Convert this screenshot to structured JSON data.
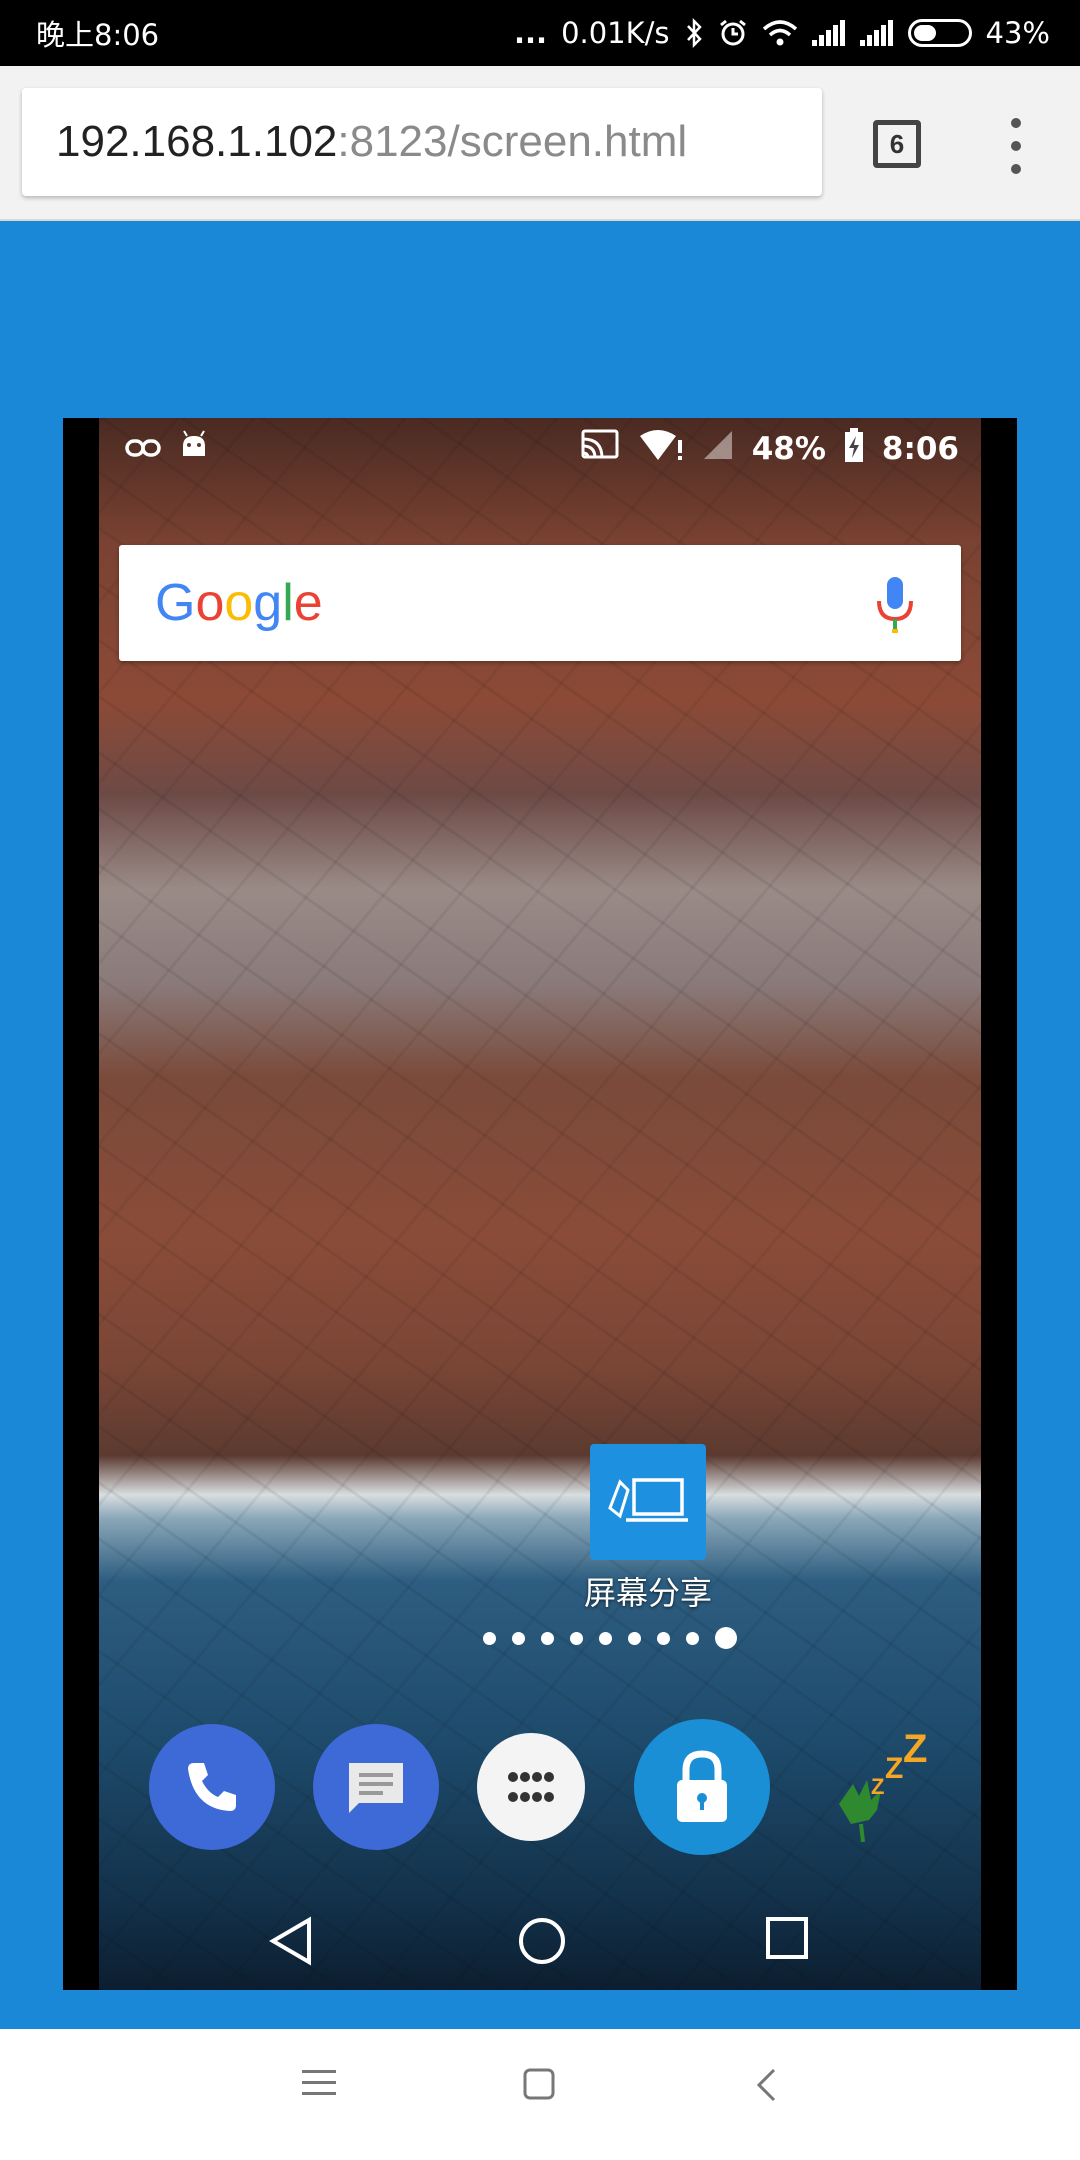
{
  "system_status": {
    "time": "晚上8:06",
    "dots": "...",
    "speed": "0.01K/s",
    "battery": "43%",
    "battery_level": 0.43
  },
  "browser": {
    "url_host": "192.168.1.102",
    "url_path": ":8123/screen.html",
    "tab_count": "6"
  },
  "colors": {
    "page_background": "#1a88d6",
    "app_icon": "#1e90e0"
  },
  "mirrored_screen": {
    "status": {
      "battery": "48%",
      "time": "8:06"
    },
    "google_search": {
      "logo": "Google"
    },
    "home_app": {
      "label": "屏幕分享",
      "icon": "screen-share-icon"
    },
    "page_indicator": {
      "count": 9,
      "active_index": 8
    },
    "dock": [
      "phone-icon",
      "messages-icon",
      "app-drawer-icon",
      "lock-icon",
      "sleep-icon"
    ],
    "nav": [
      "back-icon",
      "home-icon",
      "recents-icon"
    ]
  },
  "system_nav": [
    "menu-icon",
    "home-icon",
    "back-icon"
  ]
}
